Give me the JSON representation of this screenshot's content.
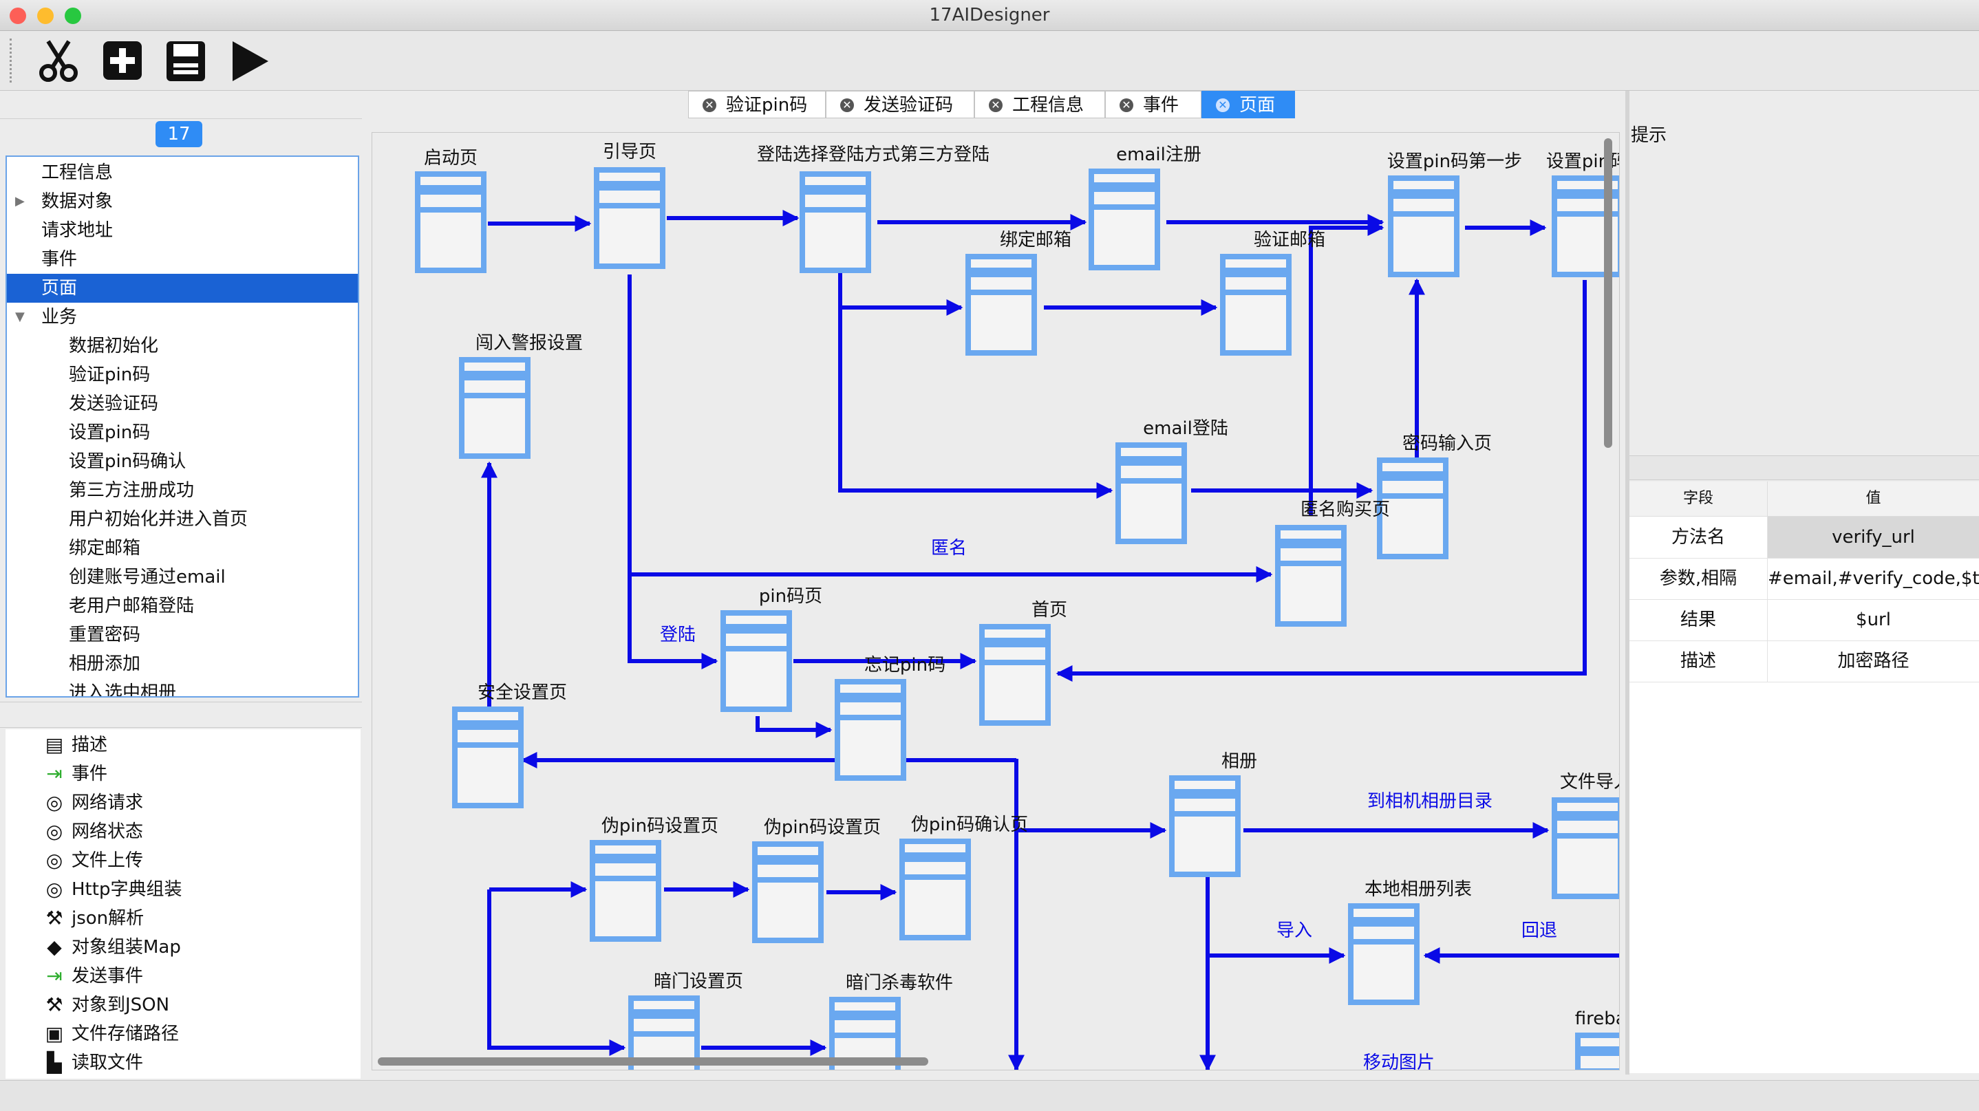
{
  "window": {
    "title": "17AIDesigner"
  },
  "toolbar": {
    "tools": [
      "scissors-icon",
      "add-icon",
      "save-icon",
      "play-icon"
    ]
  },
  "project_badge": "17",
  "tree": [
    {
      "label": "工程信息",
      "indent": 0,
      "arrow": ""
    },
    {
      "label": "数据对象",
      "indent": 0,
      "arrow": "▶"
    },
    {
      "label": "请求地址",
      "indent": 0,
      "arrow": ""
    },
    {
      "label": "事件",
      "indent": 0,
      "arrow": ""
    },
    {
      "label": "页面",
      "indent": 0,
      "arrow": "",
      "selected": true
    },
    {
      "label": "业务",
      "indent": 0,
      "arrow": "▼"
    },
    {
      "label": "数据初始化",
      "indent": 1,
      "arrow": ""
    },
    {
      "label": "验证pin码",
      "indent": 1,
      "arrow": ""
    },
    {
      "label": "发送验证码",
      "indent": 1,
      "arrow": ""
    },
    {
      "label": "设置pin码",
      "indent": 1,
      "arrow": ""
    },
    {
      "label": "设置pin码确认",
      "indent": 1,
      "arrow": ""
    },
    {
      "label": "第三方注册成功",
      "indent": 1,
      "arrow": ""
    },
    {
      "label": "用户初始化并进入首页",
      "indent": 1,
      "arrow": ""
    },
    {
      "label": "绑定邮箱",
      "indent": 1,
      "arrow": ""
    },
    {
      "label": "创建账号通过email",
      "indent": 1,
      "arrow": ""
    },
    {
      "label": "老用户邮箱登陆",
      "indent": 1,
      "arrow": ""
    },
    {
      "label": "重置密码",
      "indent": 1,
      "arrow": ""
    },
    {
      "label": "相册添加",
      "indent": 1,
      "arrow": ""
    },
    {
      "label": "进入选中相册",
      "indent": 1,
      "arrow": ""
    }
  ],
  "palette": [
    {
      "label": "描述",
      "icon": "▤",
      "color": "#111"
    },
    {
      "label": "事件",
      "icon": "⇥",
      "color": "#2fae2f"
    },
    {
      "label": "网络请求",
      "icon": "◎",
      "color": "#111"
    },
    {
      "label": "网络状态",
      "icon": "◎",
      "color": "#111"
    },
    {
      "label": "文件上传",
      "icon": "◎",
      "color": "#111"
    },
    {
      "label": "Http字典组装",
      "icon": "◎",
      "color": "#111"
    },
    {
      "label": "json解析",
      "icon": "⚒",
      "color": "#111"
    },
    {
      "label": "对象组装Map",
      "icon": "◆",
      "color": "#111"
    },
    {
      "label": "发送事件",
      "icon": "⇥",
      "color": "#2fae2f"
    },
    {
      "label": "对象到JSON",
      "icon": "⚒",
      "color": "#111"
    },
    {
      "label": "文件存储路径",
      "icon": "▣",
      "color": "#111"
    },
    {
      "label": "读取文件",
      "icon": "▙",
      "color": "#111"
    }
  ],
  "tabs": [
    {
      "label": "验证pin码",
      "active": false
    },
    {
      "label": "发送验证码",
      "active": false
    },
    {
      "label": "工程信息",
      "active": false
    },
    {
      "label": "事件",
      "active": false
    },
    {
      "label": "页面",
      "active": true
    }
  ],
  "diagram": {
    "nodes": [
      {
        "label": "启动页"
      },
      {
        "label": "引导页"
      },
      {
        "label": "登陆选择登陆方式第三方登陆"
      },
      {
        "label": "email注册"
      },
      {
        "label": "设置pin码第一步"
      },
      {
        "label": "设置pin码第"
      },
      {
        "label": "绑定邮箱"
      },
      {
        "label": "验证邮箱"
      },
      {
        "label": "闯入警报设置"
      },
      {
        "label": "email登陆"
      },
      {
        "label": "密码输入页"
      },
      {
        "label": "匿名购买页"
      },
      {
        "label": "pin码页"
      },
      {
        "label": "首页"
      },
      {
        "label": "忘记pin码"
      },
      {
        "label": "安全设置页"
      },
      {
        "label": "相册"
      },
      {
        "label": "文件导入"
      },
      {
        "label": "伪pin码设置页"
      },
      {
        "label": "伪pin码设置页"
      },
      {
        "label": "伪pin码确认页"
      },
      {
        "label": "本地相册列表"
      },
      {
        "label": "暗门设置页"
      },
      {
        "label": "暗门杀毒软件"
      },
      {
        "label": "firebase"
      }
    ],
    "edge_labels": [
      "匿名",
      "登陆",
      "到相机相册目录",
      "导入",
      "回退",
      "移动图片"
    ],
    "node_color": "#6aa8f0",
    "edge_color": "#0a0ae6"
  },
  "hint": {
    "label": "提示"
  },
  "props": {
    "col_field": "字段",
    "col_value": "值",
    "rows": [
      {
        "key": "方法名",
        "value": "verify_url"
      },
      {
        "key": "参数,相隔",
        "value": "#email,#verify_code,$ti"
      },
      {
        "key": "结果",
        "value": "$url"
      },
      {
        "key": "描述",
        "value": "加密路径"
      }
    ]
  }
}
